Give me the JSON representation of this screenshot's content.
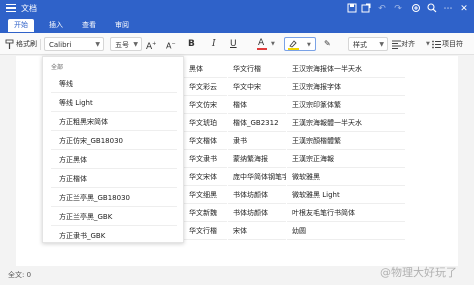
{
  "window": {
    "title": "文档"
  },
  "tabs": [
    "开始",
    "插入",
    "查看",
    "审阅"
  ],
  "toolbar": {
    "format_painter": "格式刷",
    "font_name": "Calibri",
    "font_size": "五号",
    "styles": "样式",
    "align": "对齐",
    "list": "项目符"
  },
  "font_menu": {
    "header": "全部",
    "items": [
      "等线",
      "等线 Light",
      "方正粗黑宋简体",
      "方正仿宋_GB18030",
      "方正黑体",
      "方正楷体",
      "方正兰亭黑_GB18030",
      "方正兰亭黑_GBK",
      "方正隶书_GBK"
    ]
  },
  "font_grid": {
    "rows": [
      [
        "黑体",
        "华文行楷",
        "王汉宗海报体一半天水"
      ],
      [
        "华文彩云",
        "华文中宋",
        "王汉宗海报字体"
      ],
      [
        "华文仿宋",
        "楷体",
        "王汉宗印篆体繁"
      ],
      [
        "华文琥珀",
        "楷体_GB2312",
        "王漢宗海報體一半天水"
      ],
      [
        "华文楷体",
        "隶书",
        "王漢宗顏楷體繁"
      ],
      [
        "华文隶书",
        "蒙纳繁海报",
        "王漢宗正海報"
      ],
      [
        "华文宋体",
        "庞中华简体钢笔字",
        "微软雅黑"
      ],
      [
        "华文细黑",
        "书体坊颜体",
        "微软雅黑 Light"
      ],
      [
        "华文新魏",
        "书体坊颜体",
        "叶根友毛笔行书简体"
      ],
      [
        "华文行楷",
        "宋体",
        "幼圆"
      ]
    ]
  },
  "statusbar": {
    "word_count": "全文: 0"
  },
  "watermark": "@物理大好玩了",
  "colors": {
    "accent": "#2f62c9",
    "font_color_bar": "#e03a3a",
    "highlight_bar": "#f2d600"
  }
}
